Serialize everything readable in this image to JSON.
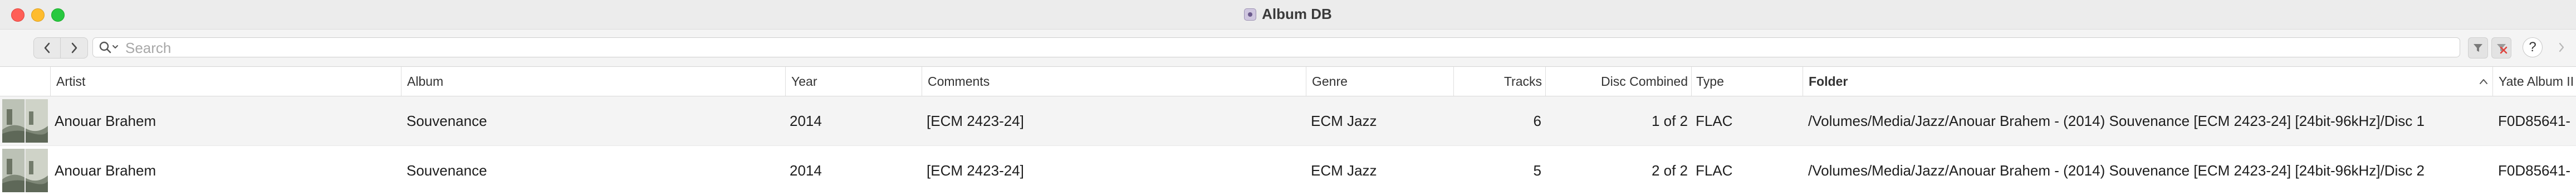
{
  "window": {
    "title": "Album DB",
    "app_icon": "album-db-app-icon"
  },
  "toolbar": {
    "back_icon": "chevron-left-icon",
    "forward_icon": "chevron-right-icon",
    "search_placeholder": "Search",
    "search_value": "",
    "filter_icon": "filter-icon",
    "clear_filter_icon": "clear-filter-icon",
    "help_label": "?",
    "more_icon": "chevron-right-icon"
  },
  "columns": {
    "artist": "Artist",
    "album": "Album",
    "year": "Year",
    "comments": "Comments",
    "genre": "Genre",
    "tracks": "Tracks",
    "disc_combined": "Disc Combined",
    "type": "Type",
    "folder": "Folder",
    "folder_sort": "ascending",
    "yate_album_id": "Yate Album II"
  },
  "rows": [
    {
      "artist": "Anouar Brahem",
      "album": "Souvenance",
      "year": "2014",
      "comments": "[ECM 2423-24]",
      "genre": "ECM Jazz",
      "tracks": "6",
      "disc_combined": "1 of 2",
      "type": "FLAC",
      "folder": "/Volumes/Media/Jazz/Anouar Brahem - (2014) Souvenance [ECM 2423-24] [24bit-96kHz]/Disc 1",
      "yate_album_id": "F0D85641-"
    },
    {
      "artist": "Anouar Brahem",
      "album": "Souvenance",
      "year": "2014",
      "comments": "[ECM 2423-24]",
      "genre": "ECM Jazz",
      "tracks": "5",
      "disc_combined": "2 of 2",
      "type": "FLAC",
      "folder": "/Volumes/Media/Jazz/Anouar Brahem - (2014) Souvenance [ECM 2423-24] [24bit-96kHz]/Disc 2",
      "yate_album_id": "F0D85641-"
    }
  ],
  "colors": {
    "close": "#ff5f57",
    "minimize": "#febc2e",
    "maximize": "#28c840",
    "selected_row": "#f4f4f4"
  }
}
